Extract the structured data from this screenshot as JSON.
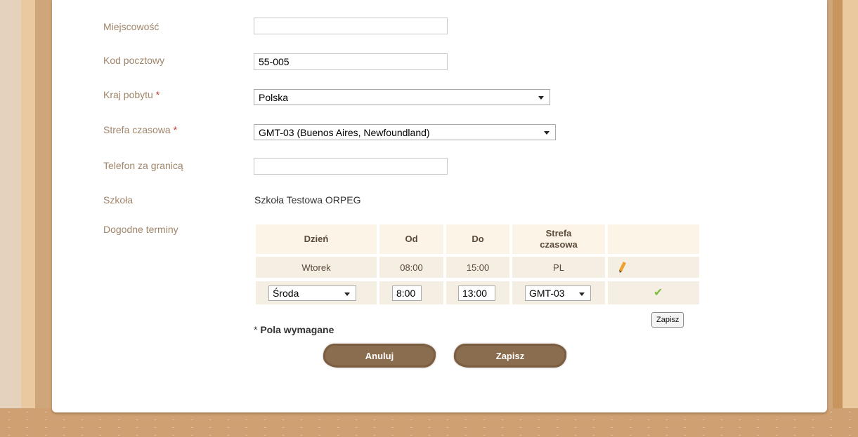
{
  "form": {
    "city_label": "Miejscowość",
    "city_value": "",
    "postal_label": "Kod pocztowy",
    "postal_value": "55-005",
    "country_label": "Kraj pobytu",
    "country_value": "Polska",
    "timezone_label": "Strefa czasowa",
    "timezone_value": "GMT-03 (Buenos Aires, Newfoundland)",
    "phone_label": "Telefon za granicą",
    "phone_value": "",
    "school_label": "Szkoła",
    "school_value": "Szkoła Testowa ORPEG",
    "terms_label": "Dogodne terminy",
    "required_mark": "*"
  },
  "terms_table": {
    "headers": [
      "Dzień",
      "Od",
      "Do",
      "Strefa czasowa"
    ],
    "row1": {
      "day": "Wtorek",
      "from": "08:00",
      "to": "15:00",
      "zone": "PL"
    },
    "row2": {
      "day": "Środa",
      "from": "8:00",
      "to": "13:00",
      "zone": "GMT-03"
    },
    "save_small": "Zapisz"
  },
  "footer": {
    "required_note_star": "*",
    "required_note_text": "Pola wymagane",
    "cancel_label": "Anuluj",
    "save_label": "Zapisz"
  },
  "colors": {
    "label": "#a0856a",
    "required": "#c0392b",
    "button": "#8a6c4f",
    "check": "#7dbb3c"
  }
}
